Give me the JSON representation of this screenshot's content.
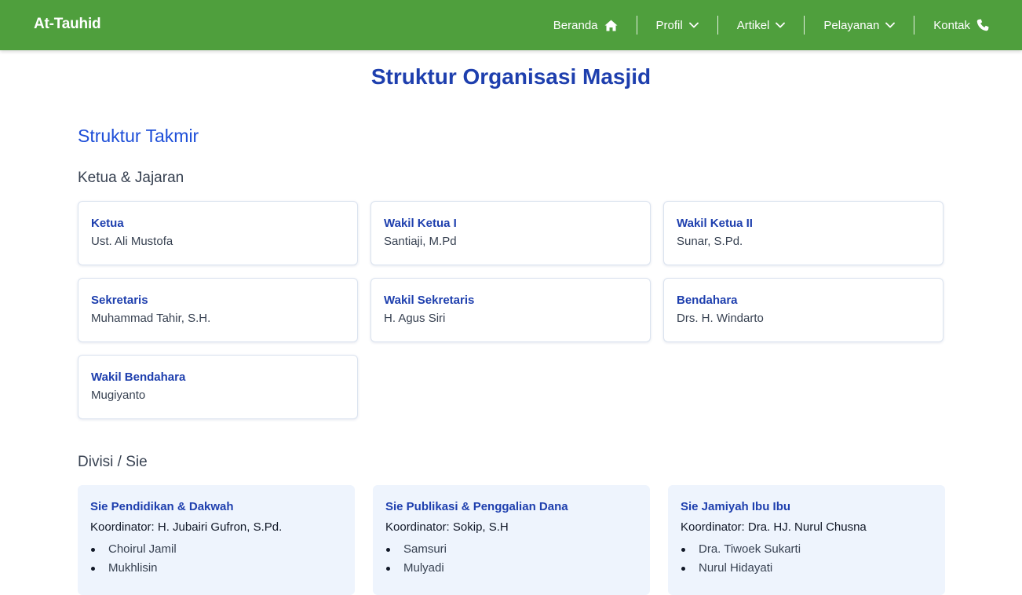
{
  "brand": "At-Tauhid",
  "nav": [
    {
      "label": "Beranda",
      "icon": "home-icon"
    },
    {
      "label": "Profil",
      "icon": "chevron-down-icon"
    },
    {
      "label": "Artikel",
      "icon": "chevron-down-icon"
    },
    {
      "label": "Pelayanan",
      "icon": "chevron-down-icon"
    },
    {
      "label": "Kontak",
      "icon": "phone-icon"
    }
  ],
  "page_title": "Struktur Organisasi Masjid",
  "section_title": "Struktur Takmir",
  "ketua_title": "Ketua & Jajaran",
  "officers": [
    {
      "role": "Ketua",
      "name": "Ust. Ali Mustofa"
    },
    {
      "role": "Wakil Ketua I",
      "name": "Santiaji, M.Pd"
    },
    {
      "role": "Wakil Ketua II",
      "name": "Sunar, S.Pd."
    },
    {
      "role": "Sekretaris",
      "name": "Muhammad Tahir, S.H."
    },
    {
      "role": "Wakil Sekretaris",
      "name": "H. Agus Siri"
    },
    {
      "role": "Bendahara",
      "name": "Drs. H. Windarto"
    },
    {
      "role": "Wakil Bendahara",
      "name": "Mugiyanto"
    }
  ],
  "divisi_title": "Divisi / Sie",
  "divisions": [
    {
      "name": "Sie Pendidikan & Dakwah",
      "coordinator": "Koordinator: H. Jubairi Gufron, S.Pd.",
      "members": [
        "Choirul Jamil",
        "Mukhlisin"
      ]
    },
    {
      "name": "Sie Publikasi & Penggalian Dana",
      "coordinator": "Koordinator: Sokip, S.H",
      "members": [
        "Samsuri",
        "Mulyadi"
      ]
    },
    {
      "name": "Sie Jamiyah Ibu Ibu",
      "coordinator": "Koordinator: Dra. HJ. Nurul Chusna",
      "members": [
        "Dra. Tiwoek Sukarti",
        "Nurul Hidayati"
      ]
    }
  ],
  "colors": {
    "nav_bg": "#4f9f3d",
    "title": "#1e3fae",
    "section": "#1d4ed8",
    "division_bg": "#eef4fd"
  }
}
